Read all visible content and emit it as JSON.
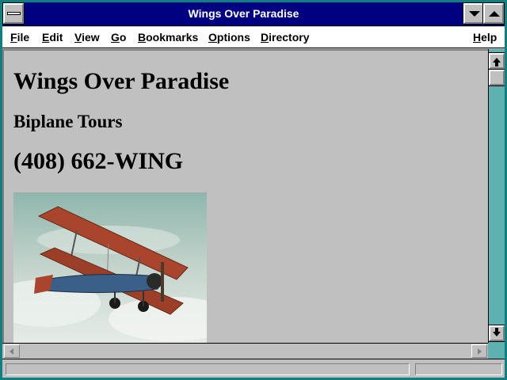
{
  "window": {
    "title": "Wings Over Paradise"
  },
  "menu": {
    "items": [
      {
        "label": "File"
      },
      {
        "label": "Edit"
      },
      {
        "label": "View"
      },
      {
        "label": "Go"
      },
      {
        "label": "Bookmarks"
      },
      {
        "label": "Options"
      },
      {
        "label": "Directory"
      },
      {
        "label": "Help"
      }
    ]
  },
  "page": {
    "heading": "Wings Over Paradise",
    "subheading": "Biplane Tours",
    "phone": "(408) 662-WING",
    "image_icon": "biplane-photo"
  },
  "status": {
    "text": ""
  },
  "colors": {
    "titlebar": "#000080",
    "background": "#c0c0c0",
    "frame": "#0f7f7f",
    "scroll_track": "#5fb0b0"
  }
}
